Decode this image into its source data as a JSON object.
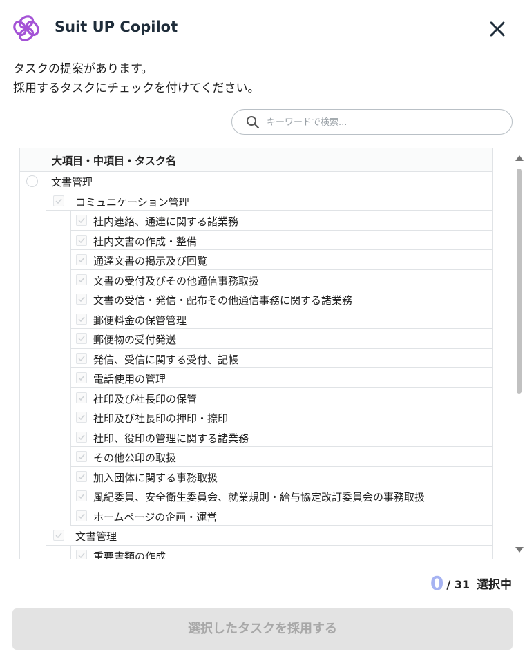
{
  "app": {
    "title": "Suit UP Copilot"
  },
  "intro": {
    "line1": "タスクの提案があります。",
    "line2": "採用するタスクにチェックを付けてください。"
  },
  "search": {
    "placeholder": "キーワードで検索...",
    "value": ""
  },
  "table": {
    "header": "大項目・中項目・タスク名",
    "rows": [
      {
        "level": 0,
        "label": "文書管理"
      },
      {
        "level": 1,
        "label": "コミュニケーション管理"
      },
      {
        "level": 2,
        "label": "社内連絡、通達に関する諸業務"
      },
      {
        "level": 2,
        "label": "社内文書の作成・整備"
      },
      {
        "level": 2,
        "label": "通達文書の掲示及び回覧"
      },
      {
        "level": 2,
        "label": "文書の受付及びその他通信事務取扱"
      },
      {
        "level": 2,
        "label": "文書の受信・発信・配布その他通信事務に関する諸業務"
      },
      {
        "level": 2,
        "label": "郵便料金の保管管理"
      },
      {
        "level": 2,
        "label": "郵便物の受付発送"
      },
      {
        "level": 2,
        "label": "発信、受信に関する受付、記帳"
      },
      {
        "level": 2,
        "label": "電話使用の管理"
      },
      {
        "level": 2,
        "label": "社印及び社長印の保管"
      },
      {
        "level": 2,
        "label": "社印及び社長印の押印・捺印"
      },
      {
        "level": 2,
        "label": "社印、役印の管理に関する諸業務"
      },
      {
        "level": 2,
        "label": "その他公印の取扱"
      },
      {
        "level": 2,
        "label": "加入団体に関する事務取扱"
      },
      {
        "level": 2,
        "label": "風紀委員、安全衛生委員会、就業規則・給与協定改訂委員会の事務取扱"
      },
      {
        "level": 2,
        "label": "ホームページの企画・運営"
      },
      {
        "level": 1,
        "label": "文書管理"
      },
      {
        "level": 2,
        "label": "重要書類の作成"
      }
    ]
  },
  "selection": {
    "count": "0",
    "total": "/ 31",
    "suffix": "選択中"
  },
  "submit": {
    "label": "選択したタスクを採用する"
  },
  "colors": {
    "brand": "#a453d6",
    "count": "#a6b3f2",
    "disabled_bg": "#e3e3e3",
    "disabled_text": "#a8a8a8"
  }
}
